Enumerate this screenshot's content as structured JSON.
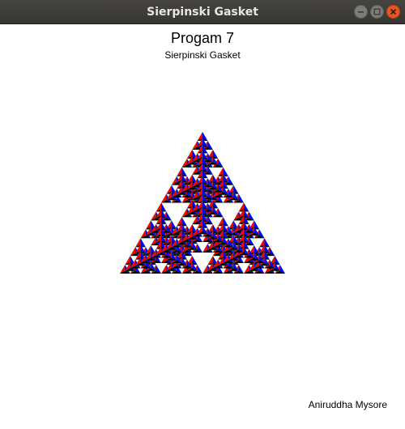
{
  "window": {
    "title": "Sierpinski Gasket",
    "controls": [
      "minimize-icon",
      "maximize-icon",
      "close-icon"
    ]
  },
  "canvas": {
    "heading": "Progam 7",
    "subheading": "Sierpinski Gasket",
    "author": "Aniruddha Mysore",
    "colors": {
      "left_face": "#ff0000",
      "right_face": "#0000ff",
      "bottom_face": "#000000",
      "fill": "#00ee00",
      "accent_close": "#e95420"
    }
  }
}
